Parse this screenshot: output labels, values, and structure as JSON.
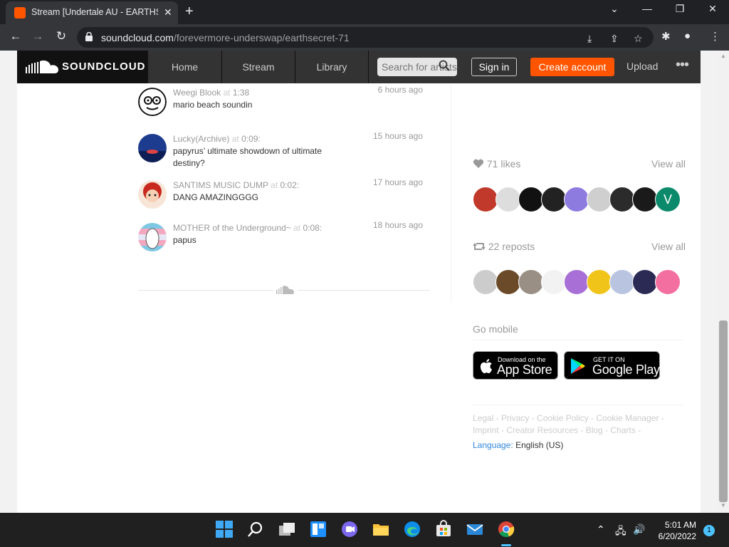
{
  "browser": {
    "tab_title": "Stream [Undertale AU - EARTHSE",
    "tab_close": "✕",
    "new_tab": "+",
    "url_domain": "soundcloud.com",
    "url_path": "/forevermore-underswap/earthsecret-71",
    "window_controls": [
      "⌄",
      "—",
      "❐",
      "✕"
    ]
  },
  "header": {
    "logo_text": "SOUNDCLOUD",
    "nav": [
      "Home",
      "Stream",
      "Library"
    ],
    "search_placeholder": "Search for artists",
    "signin": "Sign in",
    "create_account": "Create account",
    "upload": "Upload",
    "more": "•••"
  },
  "comments": [
    {
      "user": "Weegi Blook",
      "at": "at",
      "timestamp": "1:38",
      "text": "mario beach soundin",
      "time": "6 hours ago"
    },
    {
      "user": "Lucky(Archive)",
      "at": "at",
      "timestamp": "0:09:",
      "text": "papyrus’ ultimate showdown of ultimate destiny?",
      "time": "15 hours ago"
    },
    {
      "user": "SANTIMS MUSIC DUMP",
      "at": "at",
      "timestamp": "0:02:",
      "text": "DANG AMAZINGGGG",
      "time": "17 hours ago"
    },
    {
      "user": "MOTHER of the Underground~",
      "at": "at",
      "timestamp": "0:08:",
      "text": "papus",
      "time": "18 hours ago"
    }
  ],
  "sidebar": {
    "likes_label": "71 likes",
    "likes_view_all": "View all",
    "reposts_label": "22 reposts",
    "reposts_view_all": "View all",
    "go_mobile": "Go mobile",
    "appstore_small": "Download on the",
    "appstore_big": "App Store",
    "googleplay_small": "GET IT ON",
    "googleplay_big": "Google Play",
    "footer_line1": "Legal - Privacy - Cookie Policy - Cookie Manager -",
    "footer_line2": "Imprint - Creator Resources - Blog - Charts -",
    "language_label": "Language:",
    "language_value": "English (US)"
  },
  "likers": [
    {
      "color": "#c0392b",
      "initial": ""
    },
    {
      "color": "#dddddd",
      "initial": ""
    },
    {
      "color": "#111111",
      "initial": ""
    },
    {
      "color": "#222222",
      "initial": ""
    },
    {
      "color": "#8e7be0",
      "initial": ""
    },
    {
      "color": "#cfcfcf",
      "initial": ""
    },
    {
      "color": "#2b2b2b",
      "initial": ""
    },
    {
      "color": "#1a1a1a",
      "initial": ""
    },
    {
      "color": "#0b8a6b",
      "initial": "V"
    }
  ],
  "reposters": [
    {
      "color": "#cccccc"
    },
    {
      "color": "#6b4a2a"
    },
    {
      "color": "#9a8f85"
    },
    {
      "color": "#f2f2f2"
    },
    {
      "color": "#a86fd6"
    },
    {
      "color": "#f0c419"
    },
    {
      "color": "#b8c4e0"
    },
    {
      "color": "#2a2a55"
    },
    {
      "color": "#f36fa0"
    }
  ],
  "taskbar": {
    "time": "5:01 AM",
    "date": "6/20/2022",
    "notification_count": "1"
  },
  "colors": {
    "brand": "#ff5500",
    "header_bg": "#333333",
    "logo_bg": "#111111"
  }
}
